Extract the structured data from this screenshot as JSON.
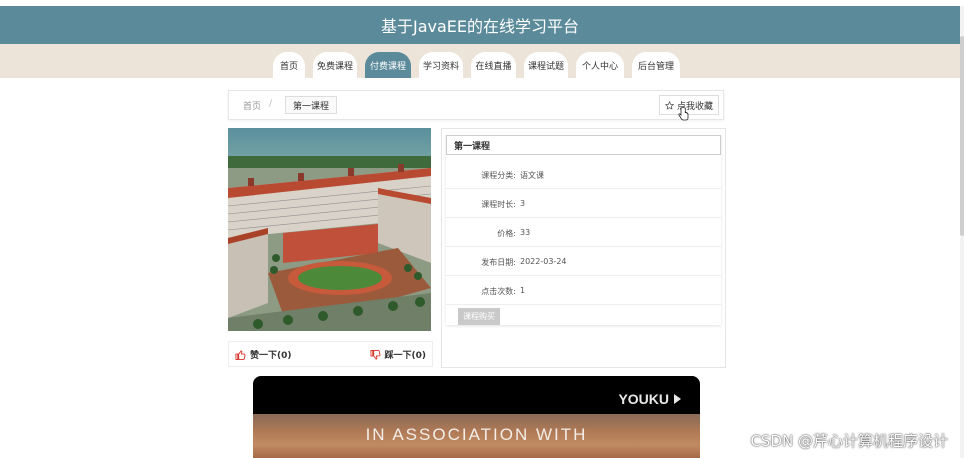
{
  "header": {
    "title": "基于JavaEE的在线学习平台"
  },
  "nav": {
    "tabs": [
      {
        "label": "首页"
      },
      {
        "label": "免费课程"
      },
      {
        "label": "付费课程"
      },
      {
        "label": "学习资料"
      },
      {
        "label": "在线直播"
      },
      {
        "label": "课程试题"
      },
      {
        "label": "个人中心"
      },
      {
        "label": "后台管理"
      }
    ],
    "active": "付费课程"
  },
  "breadcrumb": {
    "home": "首页",
    "separator": "/",
    "current": "第一课程"
  },
  "favorite": {
    "label": "点我收藏"
  },
  "course": {
    "title": "第一课程",
    "fields": [
      {
        "label": "课程分类:",
        "value": "语文课"
      },
      {
        "label": "课程时长:",
        "value": "3"
      },
      {
        "label": "价格:",
        "value": "33"
      },
      {
        "label": "发布日期:",
        "value": "2022-03-24"
      },
      {
        "label": "点击次数:",
        "value": "1"
      }
    ],
    "buy_label": "课程购买"
  },
  "votes": {
    "like_label": "赞一下(0)",
    "dislike_label": "踩一下(0)"
  },
  "video": {
    "logo": "YOUKU",
    "caption": "IN ASSOCIATION WITH"
  },
  "watermark": "CSDN @芹心计算机程序设计",
  "colors": {
    "header": "#5b8a9a",
    "nav_bg": "#ece4d8",
    "like": "#d9342b"
  }
}
